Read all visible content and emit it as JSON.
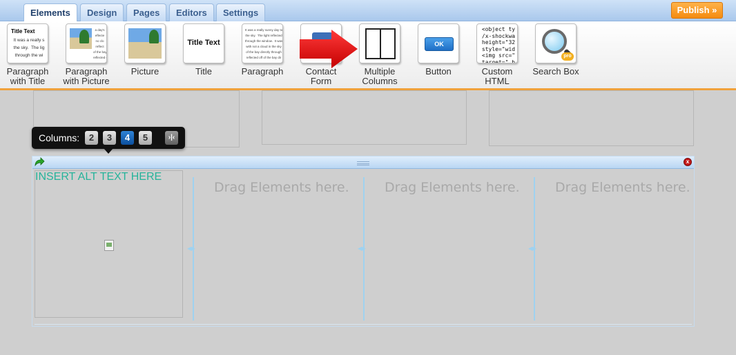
{
  "tabs": [
    {
      "label": "Elements",
      "active": true
    },
    {
      "label": "Design",
      "active": false
    },
    {
      "label": "Pages",
      "active": false
    },
    {
      "label": "Editors",
      "active": false
    },
    {
      "label": "Settings",
      "active": false
    }
  ],
  "publish_label": "Publish »",
  "elements": [
    {
      "label": "Paragraph\nwith Title",
      "icon": "paragraph-with-title-icon",
      "thumb_title": "Title Text",
      "thumb_text": "It was a really s\nthe sky.  The lig\nthrough the wi"
    },
    {
      "label": "Paragraph\nwith Picture",
      "icon": "paragraph-with-picture-icon",
      "thumb_text": "a day's\neflecte\nno clo\nreflect\nof the bay directly\nreflected off the bay d"
    },
    {
      "label": "Picture",
      "icon": "picture-icon"
    },
    {
      "label": "Title",
      "icon": "title-icon",
      "thumb_title": "Title Text"
    },
    {
      "label": "Paragraph",
      "icon": "paragraph-icon",
      "thumb_text": "It was a really sunny day to\nthe sky.  The light reflected\nthrough the window.  It was\nwith not a cloud in the sky\nof the bay directly through\nreflected off of the bay dir"
    },
    {
      "label": "Contact\nForm",
      "icon": "contact-form-icon"
    },
    {
      "label": "Multiple\nColumns",
      "icon": "multiple-columns-icon"
    },
    {
      "label": "Button",
      "icon": "button-icon",
      "thumb_button": "OK"
    },
    {
      "label": "Custom\nHTML",
      "icon": "custom-html-icon",
      "thumb_code": "<object ty\n/x-shockwa\nheight=\"32\nstyle=\"wid\n<img src=\"\ntarget=\"_b"
    },
    {
      "label": "Search Box",
      "icon": "search-box-icon",
      "thumb_badge": "pro"
    }
  ],
  "columns_popup": {
    "label": "Columns:",
    "options": [
      "2",
      "3",
      "4",
      "5"
    ],
    "selected": "4"
  },
  "row": {
    "alt_text": "INSERT ALT TEXT HERE",
    "drop_hint": "Drag Elements here.",
    "close": "x"
  },
  "colors": {
    "accent_orange": "#f48b0f",
    "alt_text": "#26b39a",
    "column_divider": "#9fd2f0",
    "arrow_red": "#e01010"
  }
}
